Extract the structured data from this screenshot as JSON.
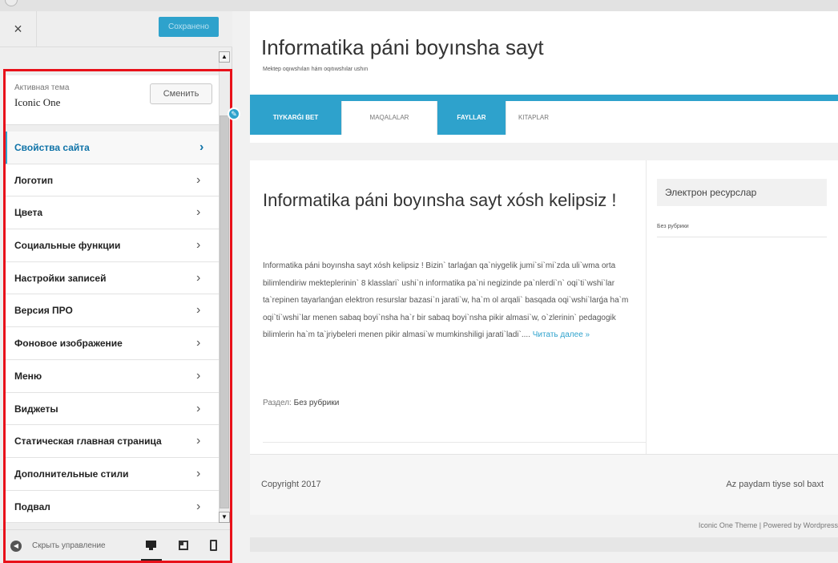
{
  "customizer": {
    "saved_label": "Сохранено",
    "close_glyph": "×",
    "active_theme_label": "Активная тема",
    "active_theme_name": "Iconic One",
    "change_label": "Сменить",
    "chevron": "›",
    "sections": [
      {
        "label": "Свойства сайта",
        "active": true
      },
      {
        "label": "Логотип"
      },
      {
        "label": "Цвета"
      },
      {
        "label": "Социальные функции"
      },
      {
        "label": "Настройки записей"
      },
      {
        "label": "Версия ПРО"
      },
      {
        "label": "Фоновое изображение"
      },
      {
        "label": "Меню"
      },
      {
        "label": "Виджеты"
      },
      {
        "label": "Статическая главная страница"
      },
      {
        "label": "Дополнительные стили"
      },
      {
        "label": "Подвал"
      }
    ],
    "collapse_label": "Скрыть управление",
    "accent_color": "#2ea2cc",
    "highlight_frame_color": "#e8111a"
  },
  "site": {
    "title": "Informatika páni boyınsha sayt",
    "description": "Mektep oqıwshıları hám oqıtıwshılar ushın",
    "nav": [
      "TIYKARǴI BET",
      "MAQALALAR",
      "FAYLLAR",
      "KITAPLAR"
    ],
    "article": {
      "title": "Informatika páni boyınsha sayt xósh kelipsiz !",
      "body": "Informatika páni boyınsha sayt xósh kelipsiz ! Bizin` tarlaǵan qa`niygelik jumi`si`mi`zda uli`wma orta bilimlendiriw mekteplerinin` 8 klasslari` ushi`n informatika pa`ni negizinde pa`nlerdi`n` oqi`ti`wshi`lar ta`repinen tayarlanǵan elektron resurslar bazasi`n jarati`w, ha`m ol arqali` basqada oqi`wshi`larǵa ha`m oqi`ti`wshi`lar menen sabaq boyi`nsha ha`r bir sabaq boyi`nsha pikir almasi`w, o`zlerinin` pedagogik bilimlerin ha`m ta`jriybeleri menen pikir almasi`w mumkinshiligi jarati`ladi`....",
      "read_more": "Читать далее »",
      "category_label": "Раздел:",
      "category_value": "Без рубрики"
    },
    "widget": {
      "title": "Электрон ресурслар",
      "link": "Без рубрики"
    },
    "footer": {
      "copyright": "Copyright 2017",
      "slogan": "Az paydam tiyse sol baxt"
    },
    "credits": "Iconic One Theme | Powered by Wordpress"
  }
}
